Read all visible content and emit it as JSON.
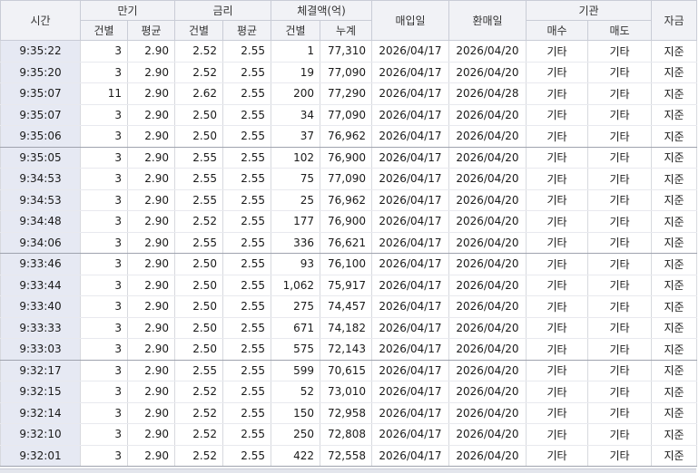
{
  "headers": {
    "time": "시간",
    "maturity": "만기",
    "rate": "금리",
    "exec_amount": "체결액(억)",
    "buy_date": "매입일",
    "resell_date": "환매일",
    "institution": "기관",
    "fund": "자금",
    "count": "건별",
    "average": "평균",
    "cumulative": "누계",
    "buy": "매수",
    "sell": "매도"
  },
  "rows": [
    [
      "9:35:22",
      "3",
      "2.90",
      "2.52",
      "2.55",
      "1",
      "77,310",
      "2026/04/17",
      "2026/04/20",
      "기타",
      "기타",
      "지준"
    ],
    [
      "9:35:20",
      "3",
      "2.90",
      "2.52",
      "2.55",
      "19",
      "77,090",
      "2026/04/17",
      "2026/04/20",
      "기타",
      "기타",
      "지준"
    ],
    [
      "9:35:07",
      "11",
      "2.90",
      "2.62",
      "2.55",
      "200",
      "77,290",
      "2026/04/17",
      "2026/04/28",
      "기타",
      "기타",
      "지준"
    ],
    [
      "9:35:07",
      "3",
      "2.90",
      "2.50",
      "2.55",
      "34",
      "77,090",
      "2026/04/17",
      "2026/04/20",
      "기타",
      "기타",
      "지준"
    ],
    [
      "9:35:06",
      "3",
      "2.90",
      "2.50",
      "2.55",
      "37",
      "76,962",
      "2026/04/17",
      "2026/04/20",
      "기타",
      "기타",
      "지준"
    ],
    [
      "9:35:05",
      "3",
      "2.90",
      "2.55",
      "2.55",
      "102",
      "76,900",
      "2026/04/17",
      "2026/04/20",
      "기타",
      "기타",
      "지준"
    ],
    [
      "9:34:53",
      "3",
      "2.90",
      "2.55",
      "2.55",
      "75",
      "77,090",
      "2026/04/17",
      "2026/04/20",
      "기타",
      "기타",
      "지준"
    ],
    [
      "9:34:53",
      "3",
      "2.90",
      "2.55",
      "2.55",
      "25",
      "76,962",
      "2026/04/17",
      "2026/04/20",
      "기타",
      "기타",
      "지준"
    ],
    [
      "9:34:48",
      "3",
      "2.90",
      "2.52",
      "2.55",
      "177",
      "76,900",
      "2026/04/17",
      "2026/04/20",
      "기타",
      "기타",
      "지준"
    ],
    [
      "9:34:06",
      "3",
      "2.90",
      "2.55",
      "2.55",
      "336",
      "76,621",
      "2026/04/17",
      "2026/04/20",
      "기타",
      "기타",
      "지준"
    ],
    [
      "9:33:46",
      "3",
      "2.90",
      "2.50",
      "2.55",
      "93",
      "76,100",
      "2026/04/17",
      "2026/04/20",
      "기타",
      "기타",
      "지준"
    ],
    [
      "9:33:44",
      "3",
      "2.90",
      "2.50",
      "2.55",
      "1,062",
      "75,917",
      "2026/04/17",
      "2026/04/20",
      "기타",
      "기타",
      "지준"
    ],
    [
      "9:33:40",
      "3",
      "2.90",
      "2.50",
      "2.55",
      "275",
      "74,457",
      "2026/04/17",
      "2026/04/20",
      "기타",
      "기타",
      "지준"
    ],
    [
      "9:33:33",
      "3",
      "2.90",
      "2.50",
      "2.55",
      "671",
      "74,182",
      "2026/04/17",
      "2026/04/20",
      "기타",
      "기타",
      "지준"
    ],
    [
      "9:33:03",
      "3",
      "2.90",
      "2.50",
      "2.55",
      "575",
      "72,143",
      "2026/04/17",
      "2026/04/20",
      "기타",
      "기타",
      "지준"
    ],
    [
      "9:32:17",
      "3",
      "2.90",
      "2.55",
      "2.55",
      "599",
      "70,615",
      "2026/04/17",
      "2026/04/20",
      "기타",
      "기타",
      "지준"
    ],
    [
      "9:32:15",
      "3",
      "2.90",
      "2.52",
      "2.55",
      "52",
      "73,010",
      "2026/04/17",
      "2026/04/20",
      "기타",
      "기타",
      "지준"
    ],
    [
      "9:32:14",
      "3",
      "2.90",
      "2.52",
      "2.55",
      "150",
      "72,958",
      "2026/04/17",
      "2026/04/20",
      "기타",
      "기타",
      "지준"
    ],
    [
      "9:32:10",
      "3",
      "2.90",
      "2.52",
      "2.55",
      "250",
      "72,808",
      "2026/04/17",
      "2026/04/20",
      "기타",
      "기타",
      "지준"
    ],
    [
      "9:32:01",
      "3",
      "2.90",
      "2.52",
      "2.55",
      "422",
      "72,558",
      "2026/04/17",
      "2026/04/20",
      "기타",
      "기타",
      "지준"
    ]
  ]
}
